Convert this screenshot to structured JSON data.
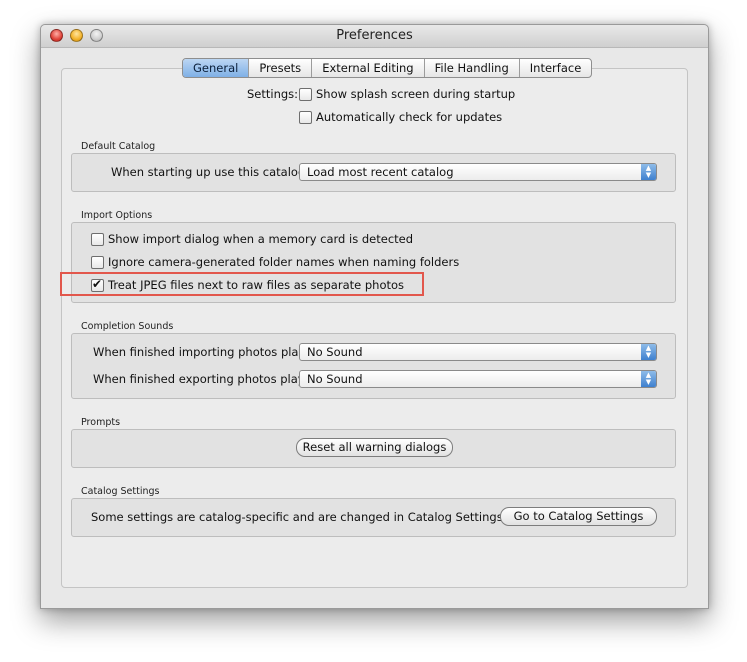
{
  "window": {
    "title": "Preferences"
  },
  "tabs": [
    {
      "label": "General",
      "active": true
    },
    {
      "label": "Presets",
      "active": false
    },
    {
      "label": "External Editing",
      "active": false
    },
    {
      "label": "File Handling",
      "active": false
    },
    {
      "label": "Interface",
      "active": false
    }
  ],
  "settings": {
    "label": "Settings:",
    "splash": {
      "label": "Show splash screen during startup",
      "checked": false
    },
    "updates": {
      "label": "Automatically check for updates",
      "checked": false
    }
  },
  "default_catalog": {
    "section": "Default Catalog",
    "prompt": "When starting up use this catalog:",
    "value": "Load most recent catalog"
  },
  "import_options": {
    "section": "Import Options",
    "items": [
      {
        "label": "Show import dialog when a memory card is detected",
        "checked": false
      },
      {
        "label": "Ignore camera-generated folder names when naming folders",
        "checked": false
      },
      {
        "label": "Treat JPEG files next to raw files as separate photos",
        "checked": true
      }
    ]
  },
  "completion_sounds": {
    "section": "Completion Sounds",
    "importing": {
      "label": "When finished importing photos play:",
      "value": "No Sound"
    },
    "exporting": {
      "label": "When finished exporting photos play:",
      "value": "No Sound"
    }
  },
  "prompts": {
    "section": "Prompts",
    "reset_button": "Reset all warning dialogs"
  },
  "catalog_settings": {
    "section": "Catalog Settings",
    "text": "Some settings are catalog-specific and are changed in Catalog Settings.",
    "button": "Go to Catalog Settings"
  },
  "glyphs": {
    "check": "✔",
    "up": "▲",
    "down": "▼"
  },
  "colors": {
    "highlight": "#e2574c",
    "accent": "#3f80cf"
  }
}
